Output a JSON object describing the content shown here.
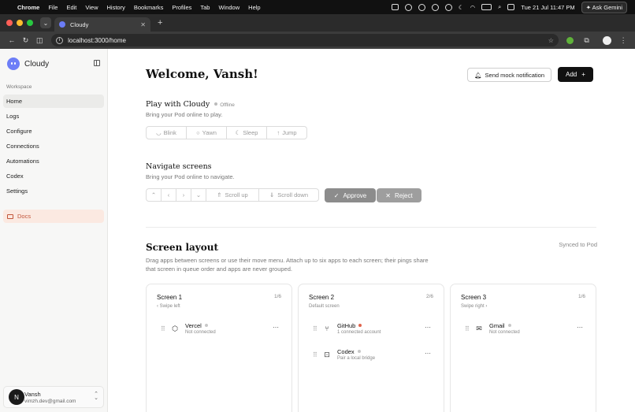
{
  "os_menubar": {
    "app_name": "Chrome",
    "menus": [
      "File",
      "Edit",
      "View",
      "History",
      "Bookmarks",
      "Profiles",
      "Tab",
      "Window",
      "Help"
    ],
    "clock": "Tue 21 Jul  11:47 PM",
    "ask_label": "Ask Gemini"
  },
  "browser": {
    "tab_title": "Cloudy",
    "url": "localhost:3000/home"
  },
  "sidebar": {
    "brand": "Cloudy",
    "section_label": "Workspace",
    "items": [
      {
        "label": "Home",
        "active": true
      },
      {
        "label": "Logs"
      },
      {
        "label": "Configure"
      },
      {
        "label": "Connections"
      },
      {
        "label": "Automations"
      },
      {
        "label": "Codex"
      },
      {
        "label": "Settings"
      }
    ],
    "docs_label": "Docs",
    "user": {
      "initial": "N",
      "name": "Vansh",
      "email": "vimzh.dev@gmail.com"
    }
  },
  "main": {
    "title": "Welcome, Vansh!",
    "send_mock_label": "Send mock notification",
    "add_label": "Add",
    "play": {
      "title": "Play with Cloudy",
      "status": "Offline",
      "subtitle": "Bring your Pod online to play.",
      "actions": [
        "Blink",
        "Yawn",
        "Sleep",
        "Jump"
      ]
    },
    "navigate": {
      "title": "Navigate screens",
      "subtitle": "Bring your Pod online to navigate.",
      "scroll_up": "Scroll up",
      "scroll_down": "Scroll down",
      "approve": "Approve",
      "reject": "Reject"
    },
    "layout": {
      "title": "Screen layout",
      "sync_status": "Synced to Pod",
      "description": "Drag apps between screens or use their move menu. Attach up to six apps to each screen; their pings share that screen in queue order and apps are never grouped.",
      "screens": [
        {
          "title": "Screen 1",
          "count": "1/6",
          "sub": "Swipe left",
          "apps": [
            {
              "name": "Vercel",
              "status": "Not connected",
              "dot": "#c8c8c8"
            }
          ]
        },
        {
          "title": "Screen 2",
          "count": "2/6",
          "sub": "Default screen",
          "apps": [
            {
              "name": "GitHub",
              "status": "1 connected account",
              "dot": "#e0644c"
            },
            {
              "name": "Codex",
              "status": "Pair a local bridge",
              "dot": "#c8c8c8"
            }
          ]
        },
        {
          "title": "Screen 3",
          "count": "1/6",
          "sub": "Swipe right",
          "apps": [
            {
              "name": "Gmail",
              "status": "Not connected",
              "dot": "#c8c8c8"
            }
          ]
        }
      ]
    }
  }
}
